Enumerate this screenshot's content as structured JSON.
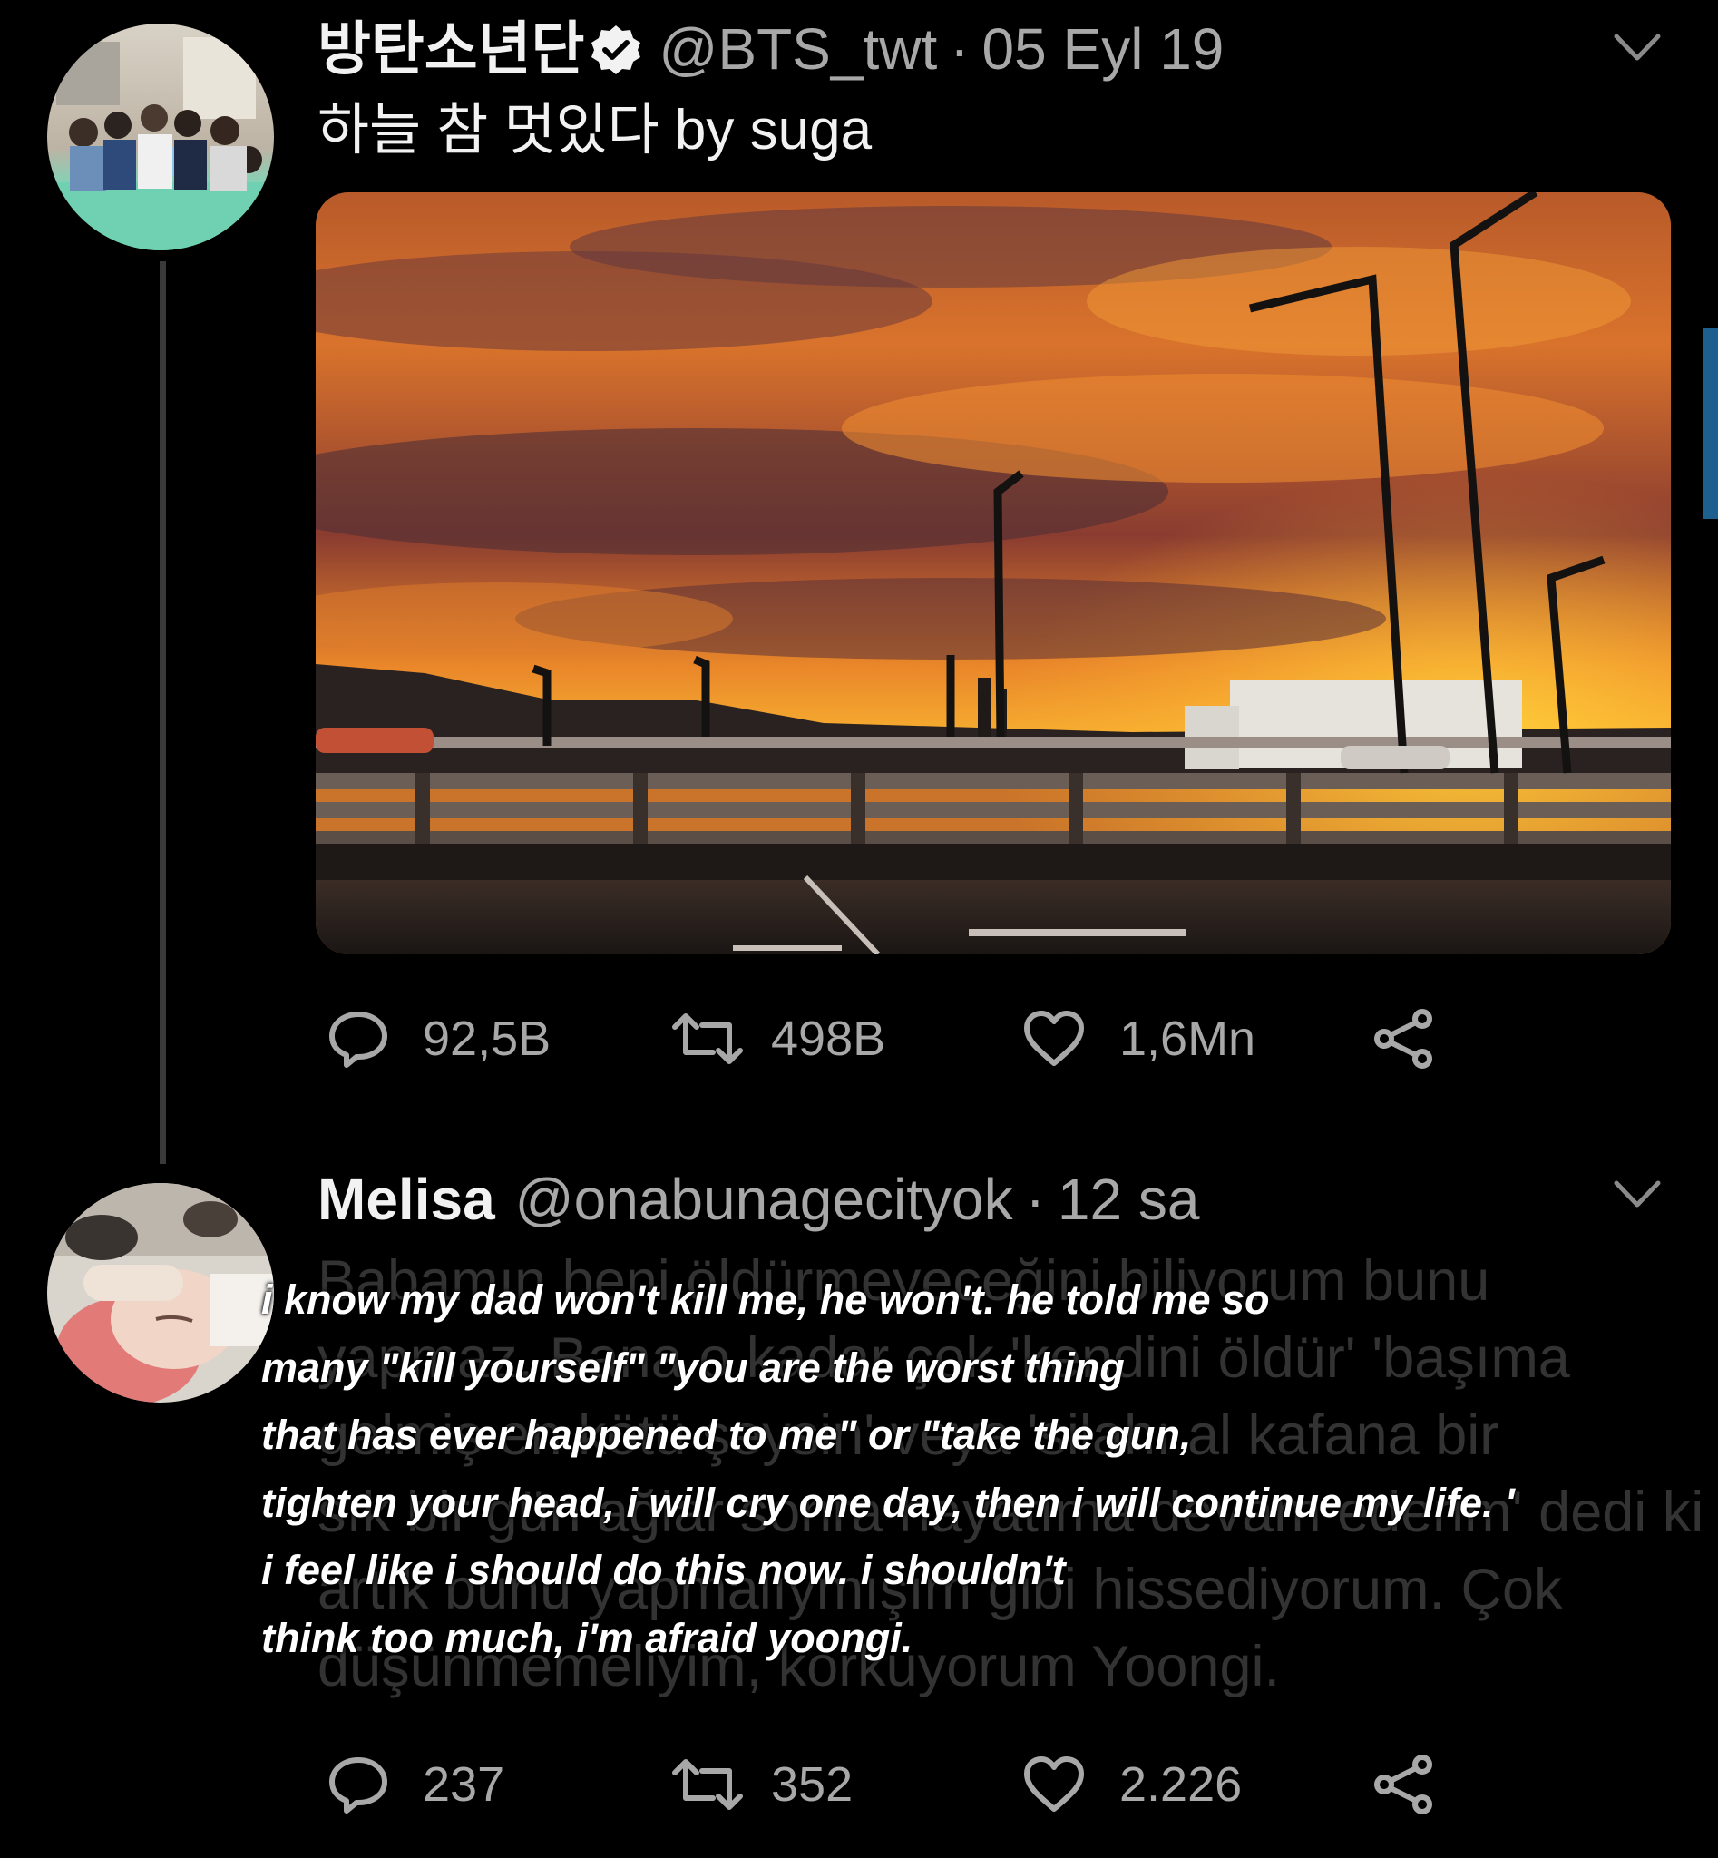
{
  "tweet": {
    "author_name": "방탄소년단",
    "handle": "@BTS_twt",
    "separator": "·",
    "date": "05 Eyl 19",
    "text": "하늘 참 멋있다 by suga",
    "actions": {
      "replies": "92,5B",
      "retweets": "498B",
      "likes": "1,6Mn"
    }
  },
  "reply": {
    "author_name": "Melisa",
    "handle": "@onabunagecityok",
    "separator": "·",
    "time": "12 sa",
    "text_lines": [
      "Babamın beni öldürmeyeceğini biliyorum bunu",
      "yapmaz. Bana o kadar çok 'kendini öldür' 'başıma",
      "gelmiş en kötü şeysin' veya 'silahı al kafana bir",
      "sık bir gün ağlar sonra hayatıma devam ederim' dedi ki",
      "artık bunu yapmalıymışım gibi hissediyorum. Çok",
      "düşünmemeliyim, korkuyorum Yoongi."
    ],
    "actions": {
      "replies": "237",
      "retweets": "352",
      "likes": "2.226"
    }
  },
  "overlay_translation": [
    "i know my dad won't kill me, he won't. he told me so",
    "many \"kill yourself\" \"you are the worst thing",
    "that has ever happened to me\" or \"take the gun,",
    "tighten your head, i will cry one day, then i will continue my life. '",
    "i feel like i should do this now. i shouldn't",
    "think too much, i'm afraid yoongi."
  ],
  "icons": {
    "reply": "speech-bubble-icon",
    "retweet": "retweet-arrows-icon",
    "like": "heart-icon",
    "share": "share-nodes-icon",
    "menu": "chevron-down-icon",
    "verified": "verified-badge-icon"
  },
  "colors": {
    "background": "#000000",
    "text_primary": "#f2f2f2",
    "text_secondary": "#a8a8a8",
    "thread_line": "#3a3a3a",
    "scrollbar": "#1d5f8f"
  }
}
